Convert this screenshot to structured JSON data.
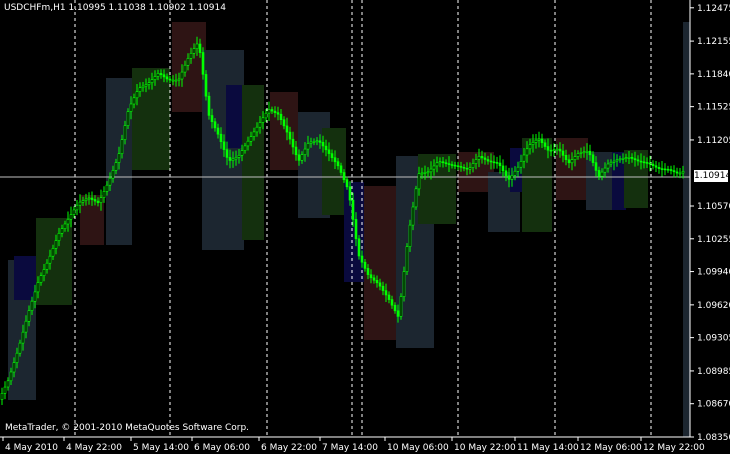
{
  "header": {
    "symbol": "USDCHFm,H1",
    "ohlc": "1.10995 1.11038 1.10902 1.10914"
  },
  "copyright": "MetaTrader, © 2001-2010 MetaQuotes Software Corp.",
  "current_price": "1.10914",
  "colors": {
    "background": "#000000",
    "candles": "#00ff00",
    "grid_vertical": "#ffffff",
    "price_line": "#c0c0c0",
    "label_text": "#ffffff",
    "box_steel": "#1c2630",
    "box_maroon": "#2e1414",
    "box_green": "#14300e",
    "box_navy": "#0a0a3e"
  },
  "chart_data": {
    "type": "line",
    "title": "USDCHFm,H1",
    "ylim": [
      1.0835,
      1.1255
    ],
    "y_ticks": [
      "1.12475",
      "1.12155",
      "1.11840",
      "1.11525",
      "1.11205",
      "1.10570",
      "1.10255",
      "1.09940",
      "1.09620",
      "1.09305",
      "1.08985",
      "1.08670",
      "1.08350"
    ],
    "x_ticks": [
      "4 May 2010",
      "4 May 22:00",
      "5 May 14:00",
      "6 May 06:00",
      "6 May 22:00",
      "7 May 14:00",
      "10 May 06:00",
      "10 May 22:00",
      "11 May 14:00",
      "12 May 06:00",
      "12 May 22:00"
    ],
    "grid": "vertical dashed",
    "series": [
      {
        "name": "USDCHFm,H1",
        "x": [
          0,
          10,
          20,
          30,
          40,
          50,
          60,
          70,
          80,
          90,
          100,
          110,
          120,
          130,
          140,
          150,
          160,
          170,
          180,
          190,
          200,
          210,
          220,
          230,
          240,
          250,
          260,
          270,
          280,
          290,
          300,
          310,
          320,
          330,
          340,
          350,
          360,
          370,
          380,
          390,
          400,
          410,
          420,
          430,
          440,
          450,
          460,
          470,
          480,
          490,
          500,
          510,
          520,
          530,
          540,
          550,
          560,
          570,
          580,
          590,
          600,
          610,
          620,
          630,
          640,
          650,
          660,
          670,
          680,
          690,
          695
        ],
        "values": [
          1.087,
          1.089,
          1.092,
          1.0955,
          1.0985,
          1.1005,
          1.103,
          1.1045,
          1.106,
          1.1065,
          1.106,
          1.108,
          1.1105,
          1.115,
          1.117,
          1.1175,
          1.1185,
          1.1178,
          1.1178,
          1.12,
          1.1215,
          1.1145,
          1.1125,
          1.11,
          1.1105,
          1.112,
          1.1135,
          1.115,
          1.1145,
          1.1125,
          1.11,
          1.1118,
          1.112,
          1.1108,
          1.1095,
          1.1072,
          1.101,
          1.099,
          1.0982,
          1.0968,
          1.095,
          1.103,
          1.1088,
          1.109,
          1.11,
          1.1097,
          1.1095,
          1.1092,
          1.1105,
          1.11,
          1.1098,
          1.1082,
          1.1095,
          1.1115,
          1.1122,
          1.111,
          1.1112,
          1.1098,
          1.1108,
          1.111,
          1.1085,
          1.1098,
          1.1102,
          1.1104,
          1.11,
          1.1098,
          1.1093,
          1.1092,
          1.1088,
          1.1093,
          1.1091
        ]
      }
    ]
  }
}
